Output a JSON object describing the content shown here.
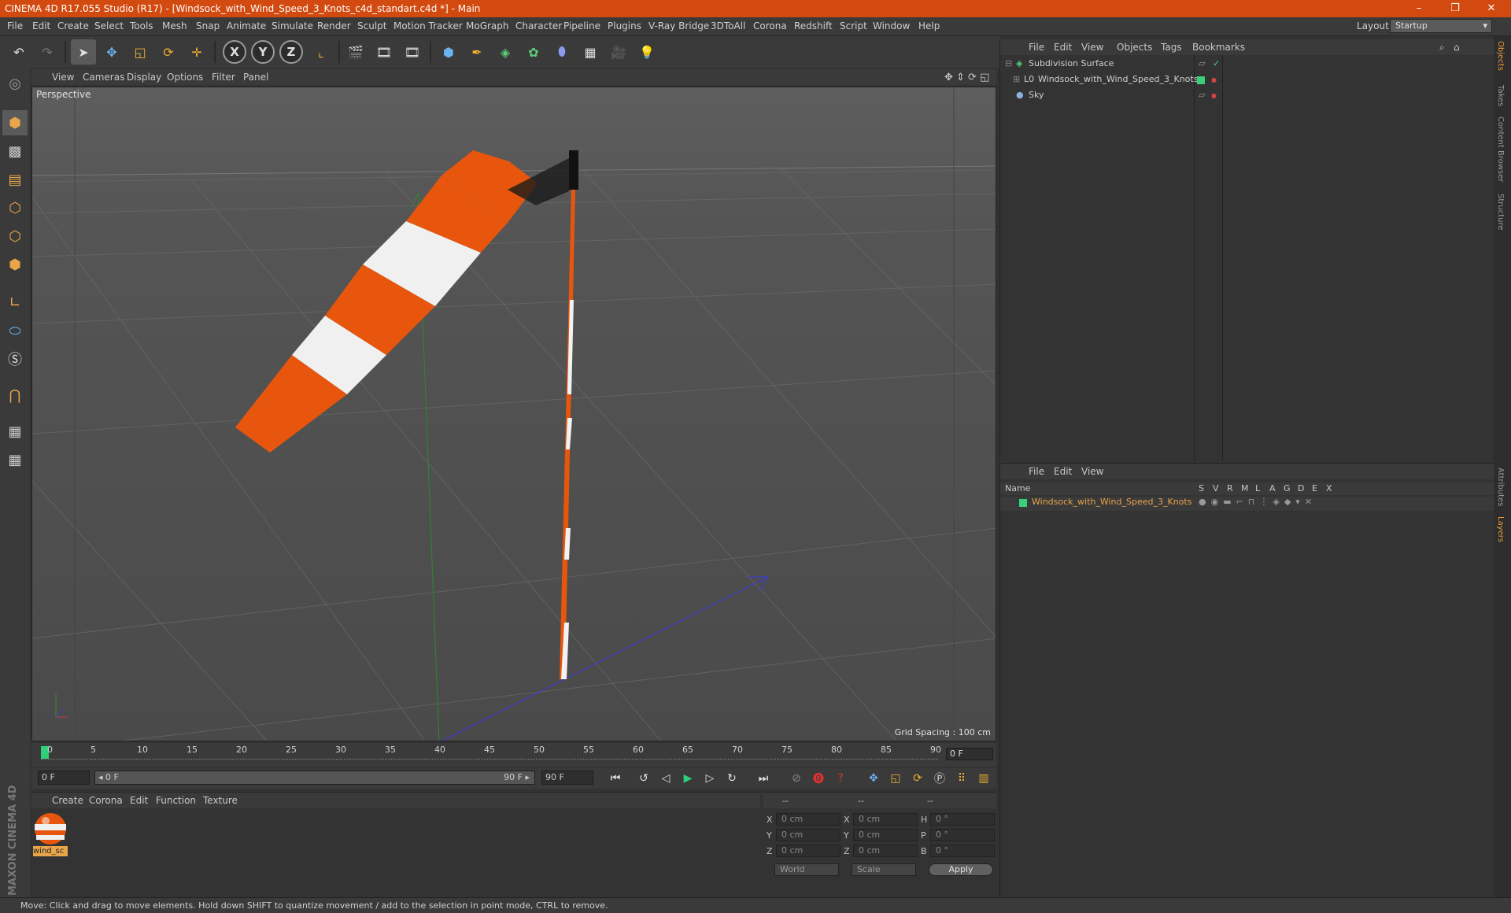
{
  "window": {
    "title": "CINEMA 4D R17.055 Studio (R17) - [Windsock_with_Wind_Speed_3_Knots_c4d_standart.c4d *] - Main",
    "controls": [
      "–",
      "❐",
      "✕"
    ]
  },
  "menubar": {
    "items": [
      "File",
      "Edit",
      "Create",
      "Select",
      "Tools",
      "Mesh",
      "Snap",
      "Animate",
      "Simulate",
      "Render",
      "Sculpt",
      "Motion Tracker",
      "MoGraph",
      "Character",
      "Pipeline",
      "Plugins",
      "V-Ray Bridge",
      "3DToAll",
      "Corona",
      "Redshift",
      "Script",
      "Window",
      "Help"
    ],
    "layout_label": "Layout:",
    "layout_value": "Startup"
  },
  "toolbar": {
    "axis_x": "X",
    "axis_y": "Y",
    "axis_z": "Z"
  },
  "viewport": {
    "menu": [
      "View",
      "Cameras",
      "Display",
      "Options",
      "Filter",
      "Panel"
    ],
    "label": "Perspective",
    "grid_spacing": "Grid Spacing : 100 cm"
  },
  "timeline": {
    "ticks": [
      "0",
      "5",
      "10",
      "15",
      "20",
      "25",
      "30",
      "35",
      "40",
      "45",
      "50",
      "55",
      "60",
      "65",
      "70",
      "75",
      "80",
      "85",
      "90"
    ],
    "current_frame": "0 F"
  },
  "playbar": {
    "start": "0 F",
    "range_start": "◂ 0 F",
    "range_end": "90 F ▸",
    "end": "90 F"
  },
  "materials": {
    "menu": [
      "Create",
      "Corona",
      "Edit",
      "Function",
      "Texture"
    ],
    "items": [
      {
        "name": "wind_sc"
      }
    ]
  },
  "coordinates": {
    "headers": [
      "--",
      "--",
      "--"
    ],
    "rows": [
      {
        "a": "X",
        "av": "0 cm",
        "b": "X",
        "bv": "0 cm",
        "c": "H",
        "cv": "0 °"
      },
      {
        "a": "Y",
        "av": "0 cm",
        "b": "Y",
        "bv": "0 cm",
        "c": "P",
        "cv": "0 °"
      },
      {
        "a": "Z",
        "av": "0 cm",
        "b": "Z",
        "bv": "0 cm",
        "c": "B",
        "cv": "0 °"
      }
    ],
    "mode1": "World",
    "mode2": "Scale",
    "apply": "Apply"
  },
  "objects": {
    "menu": [
      "File",
      "Edit",
      "View",
      "Objects",
      "Tags",
      "Bookmarks"
    ],
    "rows": [
      {
        "name": "Subdivision Surface"
      },
      {
        "name": "Windsock_with_Wind_Speed_3_Knots"
      },
      {
        "name": "Sky"
      }
    ]
  },
  "layers": {
    "menu": [
      "File",
      "Edit",
      "View"
    ],
    "header_name": "Name",
    "columns": [
      "S",
      "V",
      "R",
      "M",
      "L",
      "A",
      "G",
      "D",
      "E",
      "X"
    ],
    "rows": [
      {
        "name": "Windsock_with_Wind_Speed_3_Knots"
      }
    ]
  },
  "right_tabs": [
    "Objects",
    "Takes",
    "Content Browser",
    "Structure",
    "Attributes",
    "Layers"
  ],
  "brand": "MAXON CINEMA 4D",
  "status": "Move: Click and drag to move elements. Hold down SHIFT to quantize movement / add to the selection in point mode, CTRL to remove.",
  "colors": {
    "title_bar": "#d24a0f",
    "accent": "#e8a54a",
    "windsock_orange": "#e8560e",
    "layer_green": "#3ad07a"
  }
}
